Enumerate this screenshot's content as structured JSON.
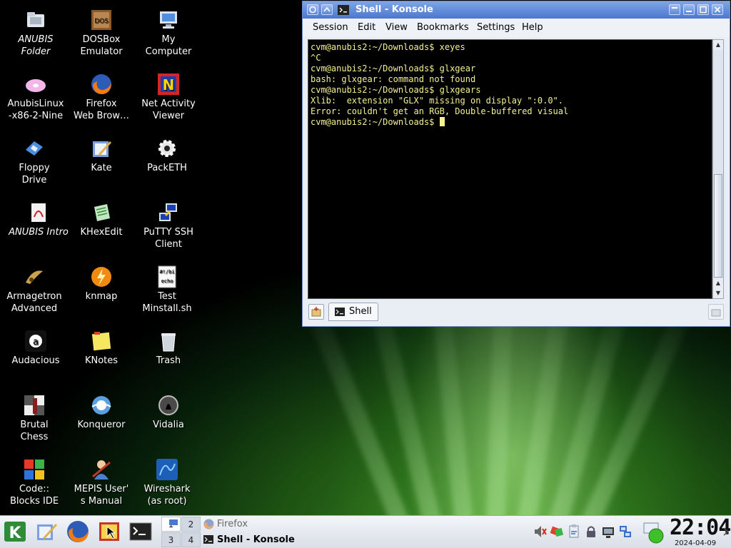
{
  "desktop": {
    "icons": [
      {
        "label": "ANUBIS\nFolder",
        "icon": "folder-icon",
        "italic": true
      },
      {
        "label": "DOSBox\nEmulator",
        "icon": "dosbox-icon"
      },
      {
        "label": "My\nComputer",
        "icon": "computer-icon"
      },
      {
        "label": "AnubisLinux\n-x86-2-Nine",
        "icon": "disc-icon"
      },
      {
        "label": "Firefox\nWeb Brow…",
        "icon": "firefox-icon"
      },
      {
        "label": "Net Activity\nViewer",
        "icon": "net-activity-icon"
      },
      {
        "label": "Floppy\nDrive",
        "icon": "floppy-icon"
      },
      {
        "label": "Kate",
        "icon": "kate-icon"
      },
      {
        "label": "PackETH",
        "icon": "gear-icon"
      },
      {
        "label": "ANUBIS Intro",
        "icon": "pdf-icon",
        "italic": true
      },
      {
        "label": "KHexEdit",
        "icon": "hexedit-icon"
      },
      {
        "label": "PuTTY SSH\nClient",
        "icon": "putty-icon"
      },
      {
        "label": "Armagetron\nAdvanced",
        "icon": "armagetron-icon"
      },
      {
        "label": "knmap",
        "icon": "knmap-icon"
      },
      {
        "label": "Test\nMinstall.sh",
        "icon": "script-file-icon"
      },
      {
        "label": "Audacious",
        "icon": "audacious-icon"
      },
      {
        "label": "KNotes",
        "icon": "notes-icon"
      },
      {
        "label": "Trash",
        "icon": "trash-icon"
      },
      {
        "label": "Brutal\nChess",
        "icon": "chess-icon"
      },
      {
        "label": "Konqueror",
        "icon": "konqueror-icon"
      },
      {
        "label": "Vidalia",
        "icon": "vidalia-icon"
      },
      {
        "label": "Code::\nBlocks IDE",
        "icon": "codeblocks-icon"
      },
      {
        "label": "MEPIS User'\ns Manual",
        "icon": "manual-icon"
      },
      {
        "label": "Wireshark\n(as root)",
        "icon": "wireshark-icon"
      }
    ]
  },
  "window": {
    "title": "Shell - Konsole",
    "menu": [
      "Session",
      "Edit",
      "View",
      "Bookmarks",
      "Settings",
      "Help"
    ],
    "terminal_lines": [
      "cvm@anubis2:~/Downloads$ xeyes",
      "^C",
      "cvm@anubis2:~/Downloads$ glxgear",
      "bash: glxgear: command not found",
      "cvm@anubis2:~/Downloads$ glxgears",
      "Xlib:  extension \"GLX\" missing on display \":0.0\".",
      "Error: couldn't get an RGB, Double-buffered visual",
      "cvm@anubis2:~/Downloads$ "
    ],
    "tab_label": "Shell"
  },
  "taskbar": {
    "pager": [
      "1",
      "2",
      "3",
      "4"
    ],
    "tasks": [
      {
        "label": "Firefox",
        "active": false
      },
      {
        "label": "Shell - Konsole",
        "active": true
      }
    ],
    "clock_time": "22:04",
    "clock_date": "2024-04-09"
  },
  "colors": {
    "terminal_text": "#f4f190",
    "titlebar": "#5b86d6"
  }
}
